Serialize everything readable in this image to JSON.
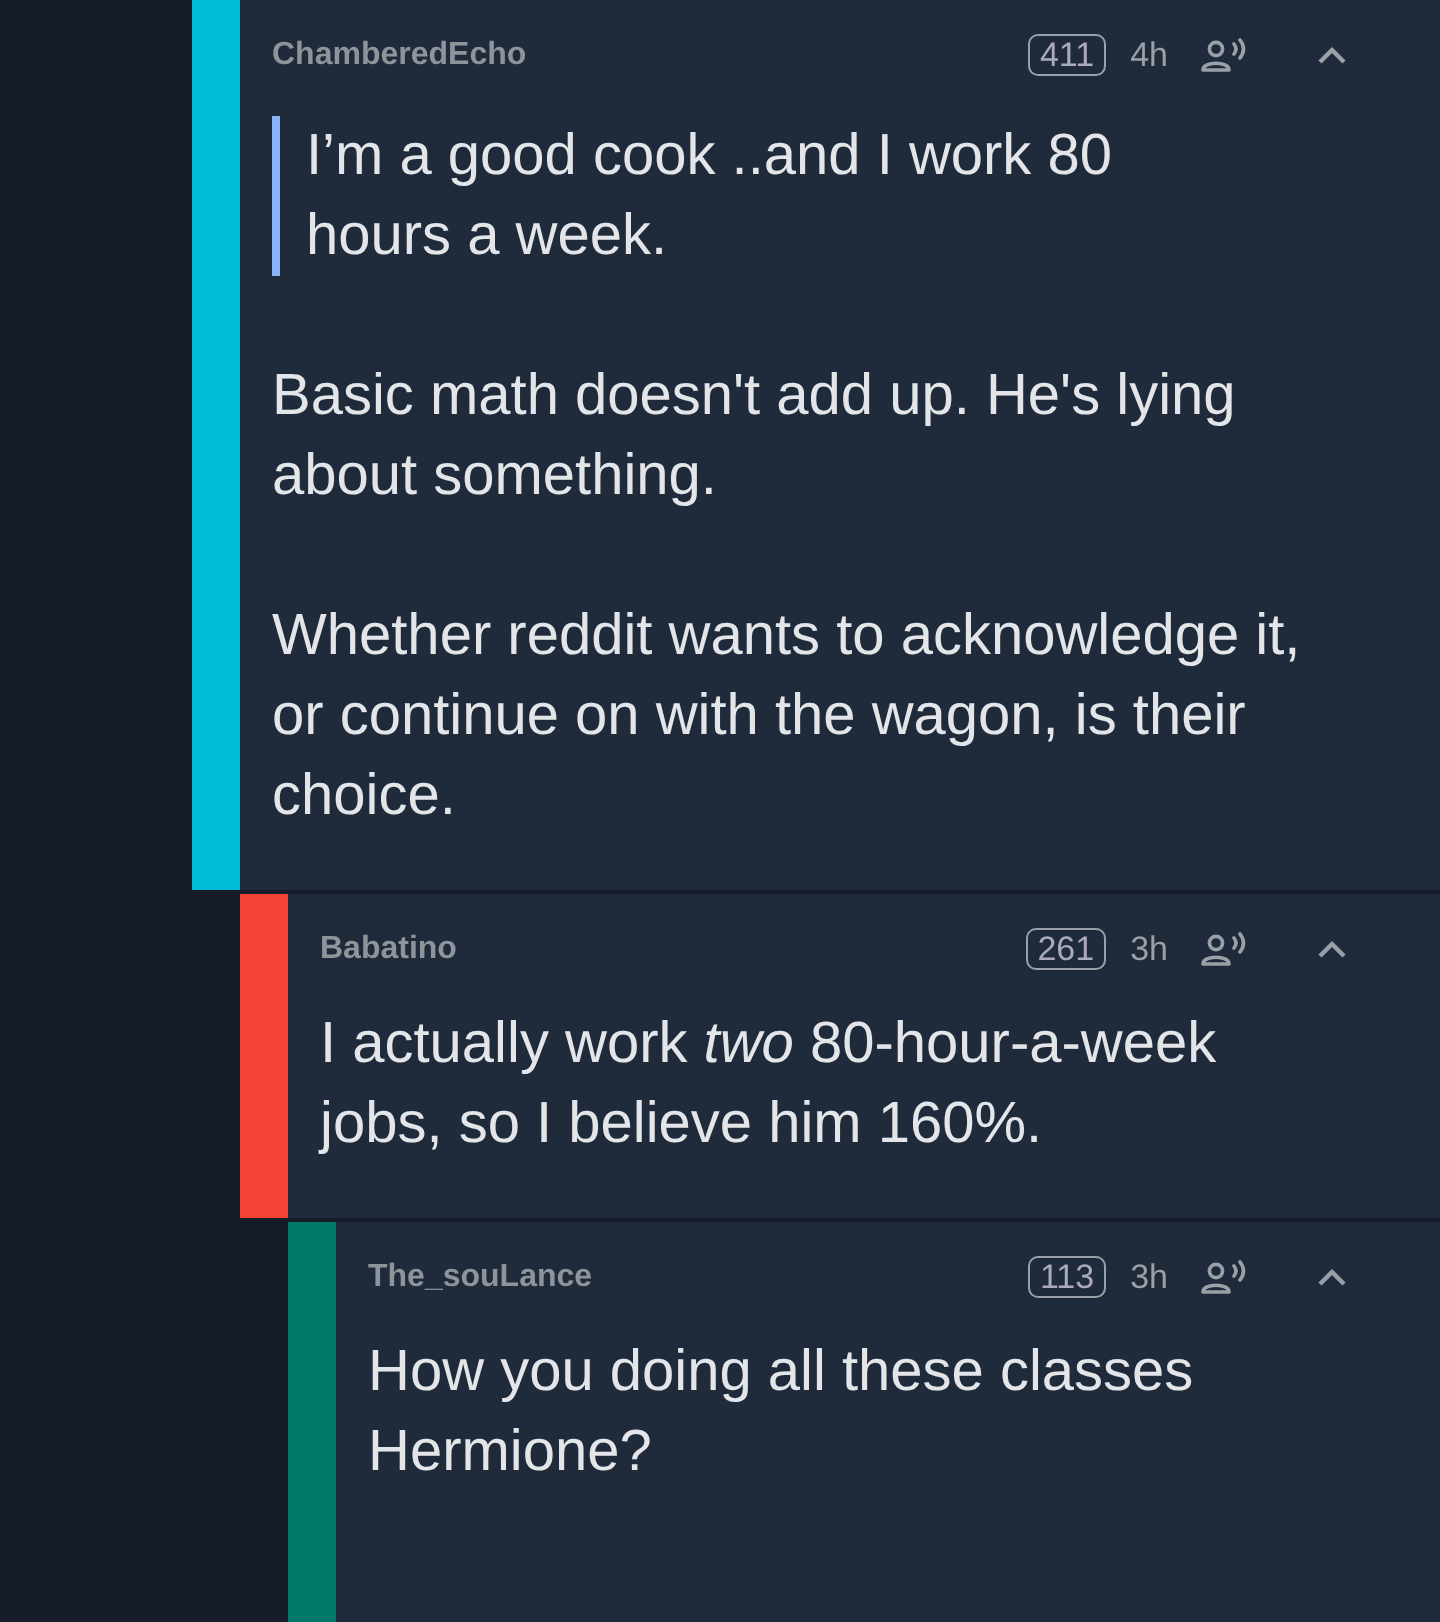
{
  "comments": [
    {
      "author": "ChamberedEcho",
      "score": "411",
      "time": "4h",
      "color": "#00bcd4",
      "blocks": [
        {
          "kind": "quote",
          "text": "I’m a good cook ..and I work 80 hours a week."
        },
        {
          "kind": "paragraph",
          "text": "Basic math doesn't add up. He's lying about something."
        },
        {
          "kind": "paragraph",
          "text": "Whether reddit wants to acknowledge it, or continue on with the wagon, is their choice."
        }
      ],
      "children": [
        {
          "author": "Babatino",
          "score": "261",
          "time": "3h",
          "color": "#f44336",
          "blocks": [
            {
              "kind": "paragraph",
              "text": "I actually work *two* 80-hour-a-week jobs, so I believe him 160%."
            }
          ],
          "children": [
            {
              "author": "The_souLance",
              "score": "113",
              "time": "3h",
              "color": "#00796b",
              "blocks": [
                {
                  "kind": "paragraph",
                  "text": "How you doing all these classes Hermione?"
                }
              ]
            }
          ]
        }
      ]
    }
  ]
}
